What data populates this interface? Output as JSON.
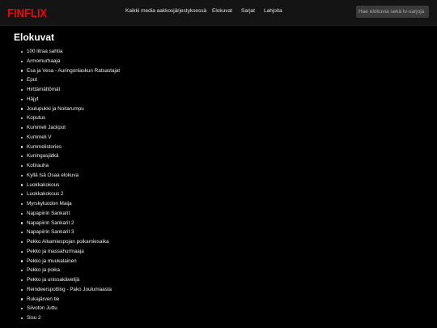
{
  "header": {
    "logo": "FINFLIX",
    "nav": [
      "Kaikki media aakkosjärjestyksessä",
      "Elokuvat",
      "Sarjat",
      "Lahjoita"
    ],
    "search": {
      "placeholder": "Hae elokuvia sekä tv-sarjoja",
      "value": ""
    }
  },
  "main": {
    "title": "Elokuvat",
    "movies": [
      "100 litraa sahtia",
      "Armomurhaaja",
      "Esa ja Vesa - Auringonlaskun Ratsastajat",
      "Eput",
      "Hirttämättömät",
      "Häjyt",
      "Joulupukki ja Noitarumpu",
      "Koputus",
      "Kummeli Jackpot",
      "Kummeli V",
      "Kummelistories",
      "Kuningasjätkä",
      "Kotirauha",
      "Kyllä Isä Osaa elokuva",
      "Luokkakokous",
      "Luokkakokous 2",
      "Myrskyluodon Maija",
      "Napapiirin Sankarit",
      "Napapiirin Sankarit 2",
      "Napapiirin Sankarit 3",
      "Pekko Aikamiespojan poikamiesaika",
      "Pekko ja massahurmaaja",
      "Pekko ja muukalainen",
      "Pekko ja poika",
      "Pekko ja unissakävelijä",
      "Reindeerspotting - Pako Joulumaasta",
      "Rukajärven tie",
      "Siivoton Juttu",
      "Sisu 2"
    ]
  },
  "colors": {
    "brand": "#e50914",
    "header_bg": "#141414",
    "page_bg": "#000000",
    "search_bg": "#3a3a3a"
  }
}
